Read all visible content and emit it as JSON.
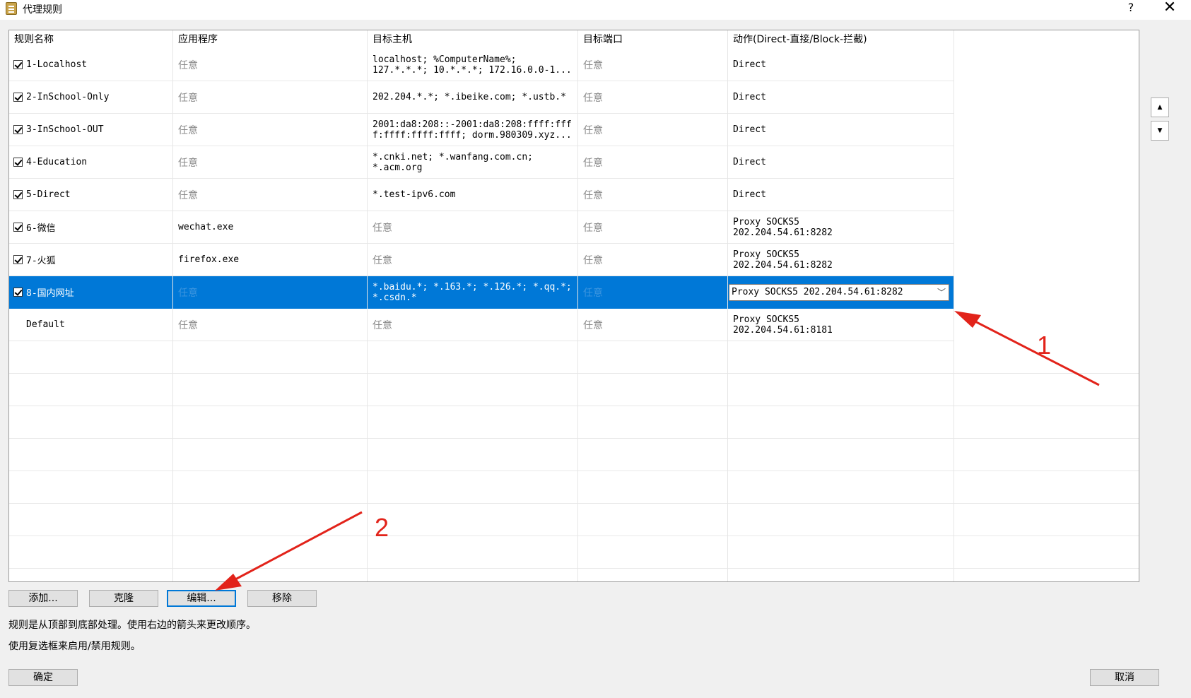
{
  "window": {
    "title": "代理规则",
    "help": "?",
    "close": "✕"
  },
  "table": {
    "headers": [
      "规则名称",
      "应用程序",
      "目标主机",
      "目标端口",
      "动作(Direct-直接/Block-拦截)"
    ],
    "rows": [
      {
        "checked": true,
        "name": "1-Localhost",
        "app": "任意",
        "host": "localhost; %ComputerName%;\n127.*.*.*; 10.*.*.*; 172.16.0.0-1...",
        "port": "任意",
        "action": "Direct"
      },
      {
        "checked": true,
        "name": "2-InSchool-Only",
        "app": "任意",
        "host": "202.204.*.*; *.ibeike.com; *.ustb.*",
        "port": "任意",
        "action": "Direct"
      },
      {
        "checked": true,
        "name": "3-InSchool-OUT",
        "app": "任意",
        "host": "2001:da8:208::-2001:da8:208:ffff:fff\nf:ffff:ffff:ffff; dorm.980309.xyz...",
        "port": "任意",
        "action": "Direct"
      },
      {
        "checked": true,
        "name": "4-Education",
        "app": "任意",
        "host": "*.cnki.net; *.wanfang.com.cn;\n*.acm.org",
        "port": "任意",
        "action": "Direct"
      },
      {
        "checked": true,
        "name": "5-Direct",
        "app": "任意",
        "host": "*.test-ipv6.com",
        "port": "任意",
        "action": "Direct"
      },
      {
        "checked": true,
        "name": "6-微信",
        "app": "wechat.exe",
        "host": "任意",
        "port": "任意",
        "action": "Proxy SOCKS5\n202.204.54.61:8282"
      },
      {
        "checked": true,
        "name": "7-火狐",
        "app": "firefox.exe",
        "host": "任意",
        "port": "任意",
        "action": "Proxy SOCKS5\n202.204.54.61:8282"
      },
      {
        "checked": true,
        "name": "8-国内网址",
        "app": "任意",
        "host": "*.baidu.*; *.163.*; *.126.*; *.qq.*;\n*.csdn.*",
        "port": "任意",
        "action": "Proxy SOCKS5 202.204.54.61:8282",
        "selected": true
      },
      {
        "checked": false,
        "name": "Default",
        "app": "任意",
        "host": "任意",
        "port": "任意",
        "action": "Proxy SOCKS5\n202.204.54.61:8181"
      }
    ]
  },
  "side_buttons": {
    "up": "▲",
    "down": "▼"
  },
  "buttons": {
    "add": "添加...",
    "clone": "克隆",
    "edit": "编辑...",
    "remove": "移除",
    "ok": "确定",
    "cancel": "取消"
  },
  "info": {
    "line1": "规则是从顶部到底部处理。使用右边的箭头来更改顺序。",
    "line2": "使用复选框来启用/禁用规则。"
  },
  "annotations": {
    "label1": "1",
    "label2": "2",
    "color": "#e2231a"
  }
}
